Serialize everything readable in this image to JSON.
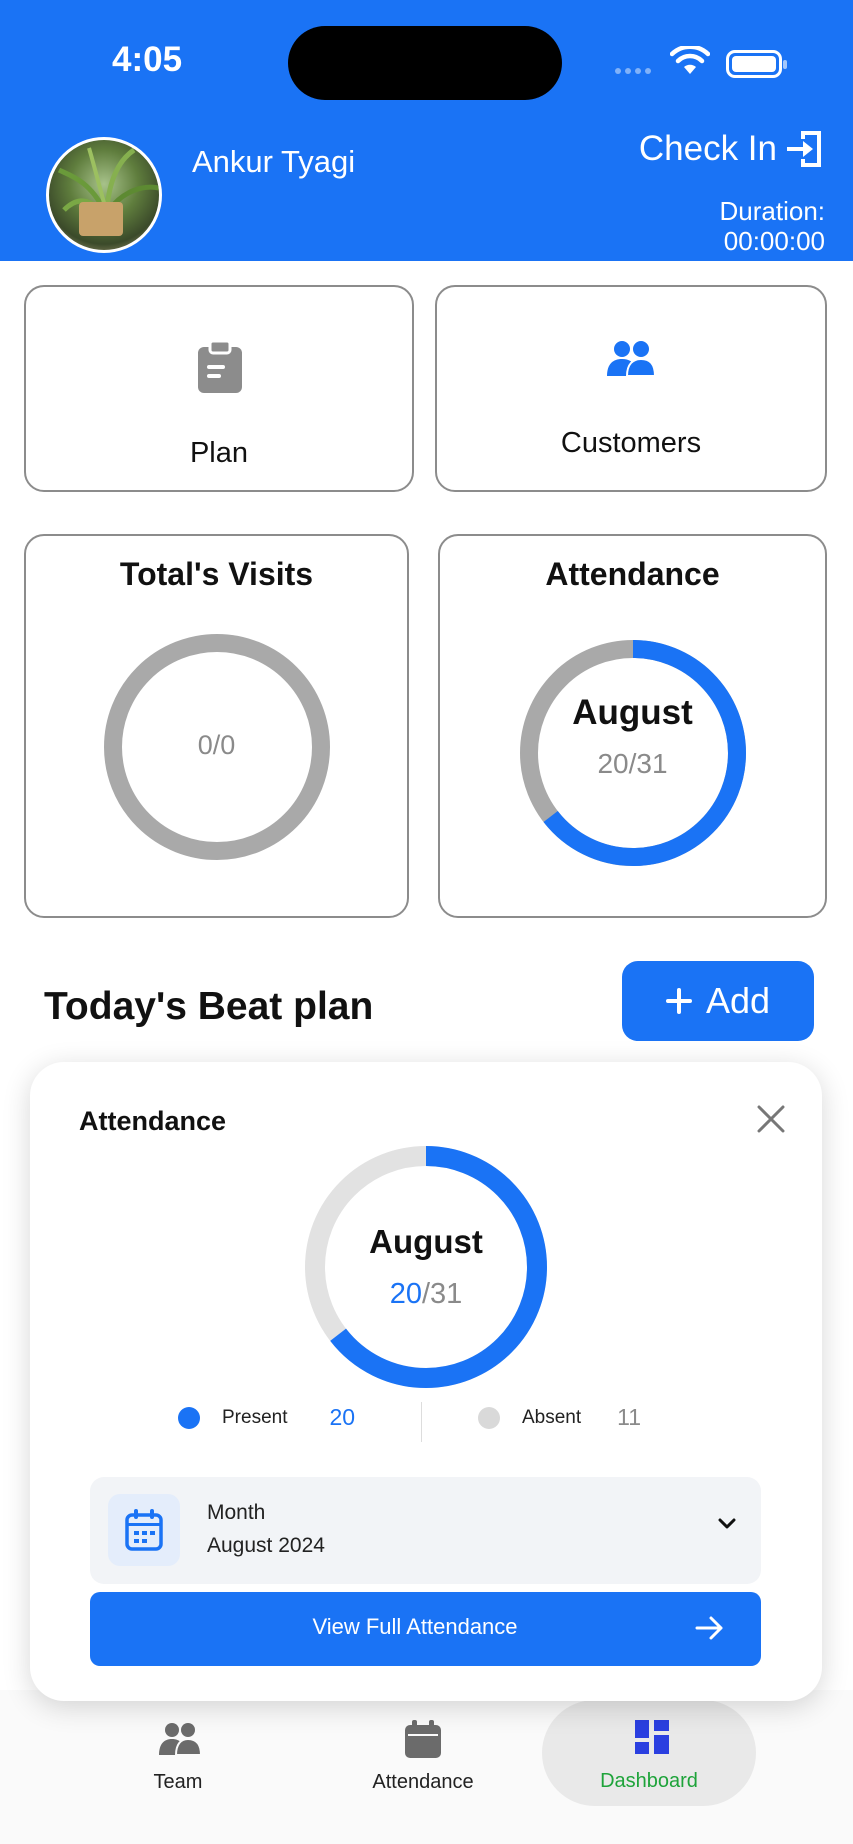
{
  "status_bar": {
    "time": "4:05"
  },
  "header": {
    "user_name": "Ankur Tyagi",
    "check_in_label": "Check In",
    "duration_label": "Duration:",
    "duration_value": "00:00:00"
  },
  "quick_actions": {
    "plan_label": "Plan",
    "customers_label": "Customers"
  },
  "visits_card": {
    "title": "Total's Visits",
    "value": "0/0",
    "progress": 0
  },
  "attendance_card": {
    "title": "Attendance",
    "month": "August",
    "value": "20/31",
    "present": 20,
    "total": 31
  },
  "beat_plan": {
    "title": "Today's Beat plan",
    "add_label": "Add"
  },
  "attendance_sheet": {
    "title": "Attendance",
    "month": "August",
    "present_value": "20",
    "total_value": "/31",
    "present_label": "Present",
    "present_count": "20",
    "absent_label": "Absent",
    "absent_count": "11",
    "month_field_label": "Month",
    "month_field_value": "August 2024",
    "view_button_label": "View Full Attendance"
  },
  "bottom_nav": {
    "team_label": "Team",
    "attendance_label": "Attendance",
    "dashboard_label": "Dashboard"
  },
  "colors": {
    "primary": "#1a73f5",
    "active_nav": "#1ea33a",
    "ring_gray": "#a9a9a9",
    "ring_light": "#e2e2e2"
  }
}
